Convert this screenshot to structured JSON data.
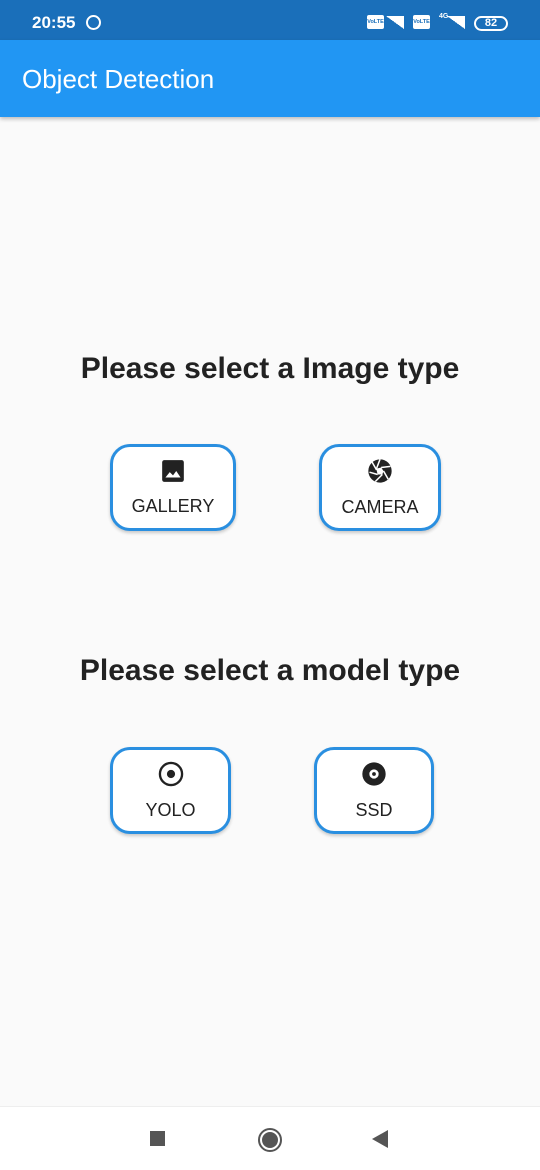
{
  "status_bar": {
    "time": "20:55",
    "battery": "82",
    "net1": "VoLTE",
    "net2": "VoLTE",
    "net2_type": "4G"
  },
  "app_bar": {
    "title": "Object Detection"
  },
  "image_section": {
    "heading": "Please select a Image type",
    "buttons": [
      {
        "label": "GALLERY",
        "icon": "image-icon"
      },
      {
        "label": "CAMERA",
        "icon": "camera-shutter-icon"
      }
    ]
  },
  "model_section": {
    "heading": "Please select a model type",
    "buttons": [
      {
        "label": "YOLO",
        "icon": "radio-target-icon"
      },
      {
        "label": "SSD",
        "icon": "disc-icon"
      }
    ]
  },
  "colors": {
    "accent": "#2196f3",
    "status": "#1a6fba",
    "border": "#2a8fe0"
  }
}
